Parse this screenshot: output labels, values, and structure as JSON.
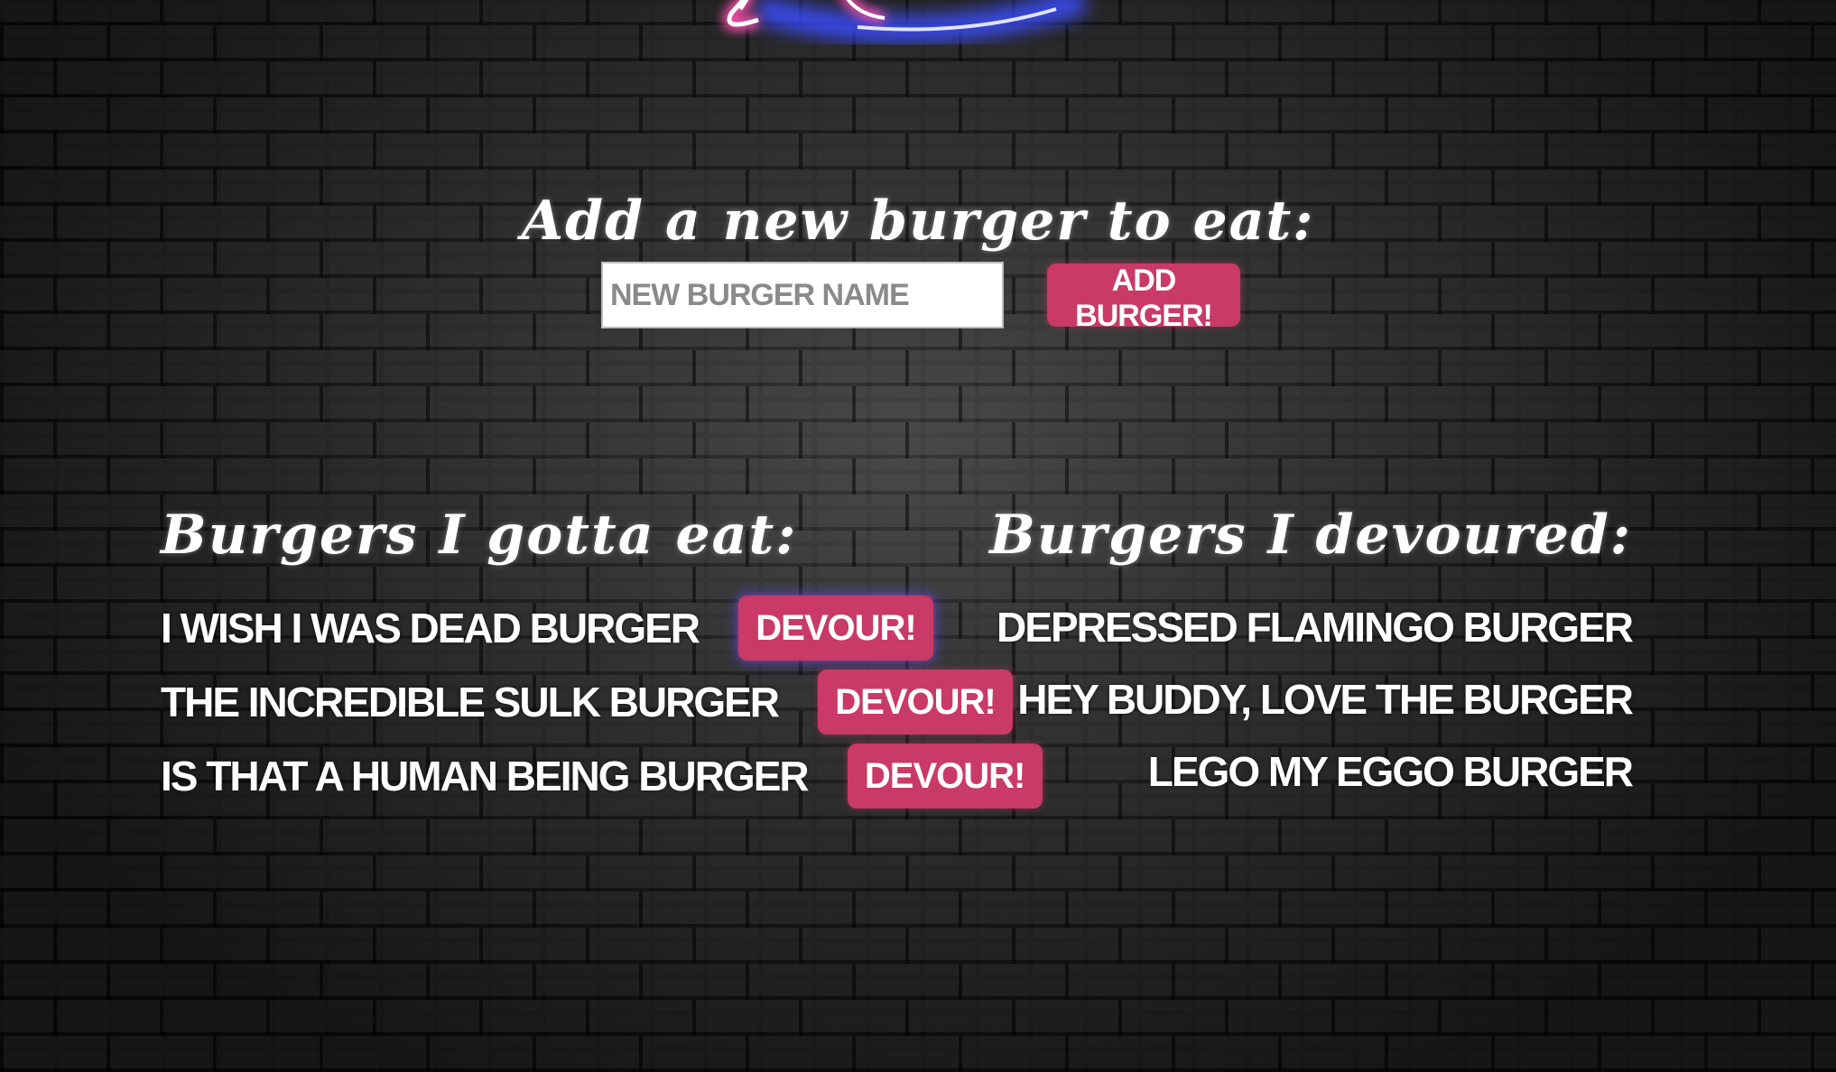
{
  "header": {
    "neon_logo_icon": "neon-sign-logo"
  },
  "add_section": {
    "heading": "Add a new burger to eat:",
    "input_placeholder": "New Burger Name",
    "input_value": "",
    "add_button_label": "Add Burger!"
  },
  "todo": {
    "heading": "Burgers I gotta eat:",
    "items": [
      {
        "name": "I wish I was dead burger",
        "button_label": "Devour!"
      },
      {
        "name": "The Incredible Sulk Burger",
        "button_label": "Devour!"
      },
      {
        "name": "Is that a human being burger",
        "button_label": "Devour!"
      }
    ]
  },
  "devoured": {
    "heading": "Burgers I devoured:",
    "items": [
      {
        "name": "Depressed Flamingo Burger"
      },
      {
        "name": "Hey Buddy, Love the Burger"
      },
      {
        "name": "Lego My Eggo Burger"
      }
    ]
  },
  "colors": {
    "button_bg": "#c93a66",
    "text": "#ffffff",
    "neon_pink": "#ff4fb0",
    "neon_blue": "#3b4dff"
  }
}
